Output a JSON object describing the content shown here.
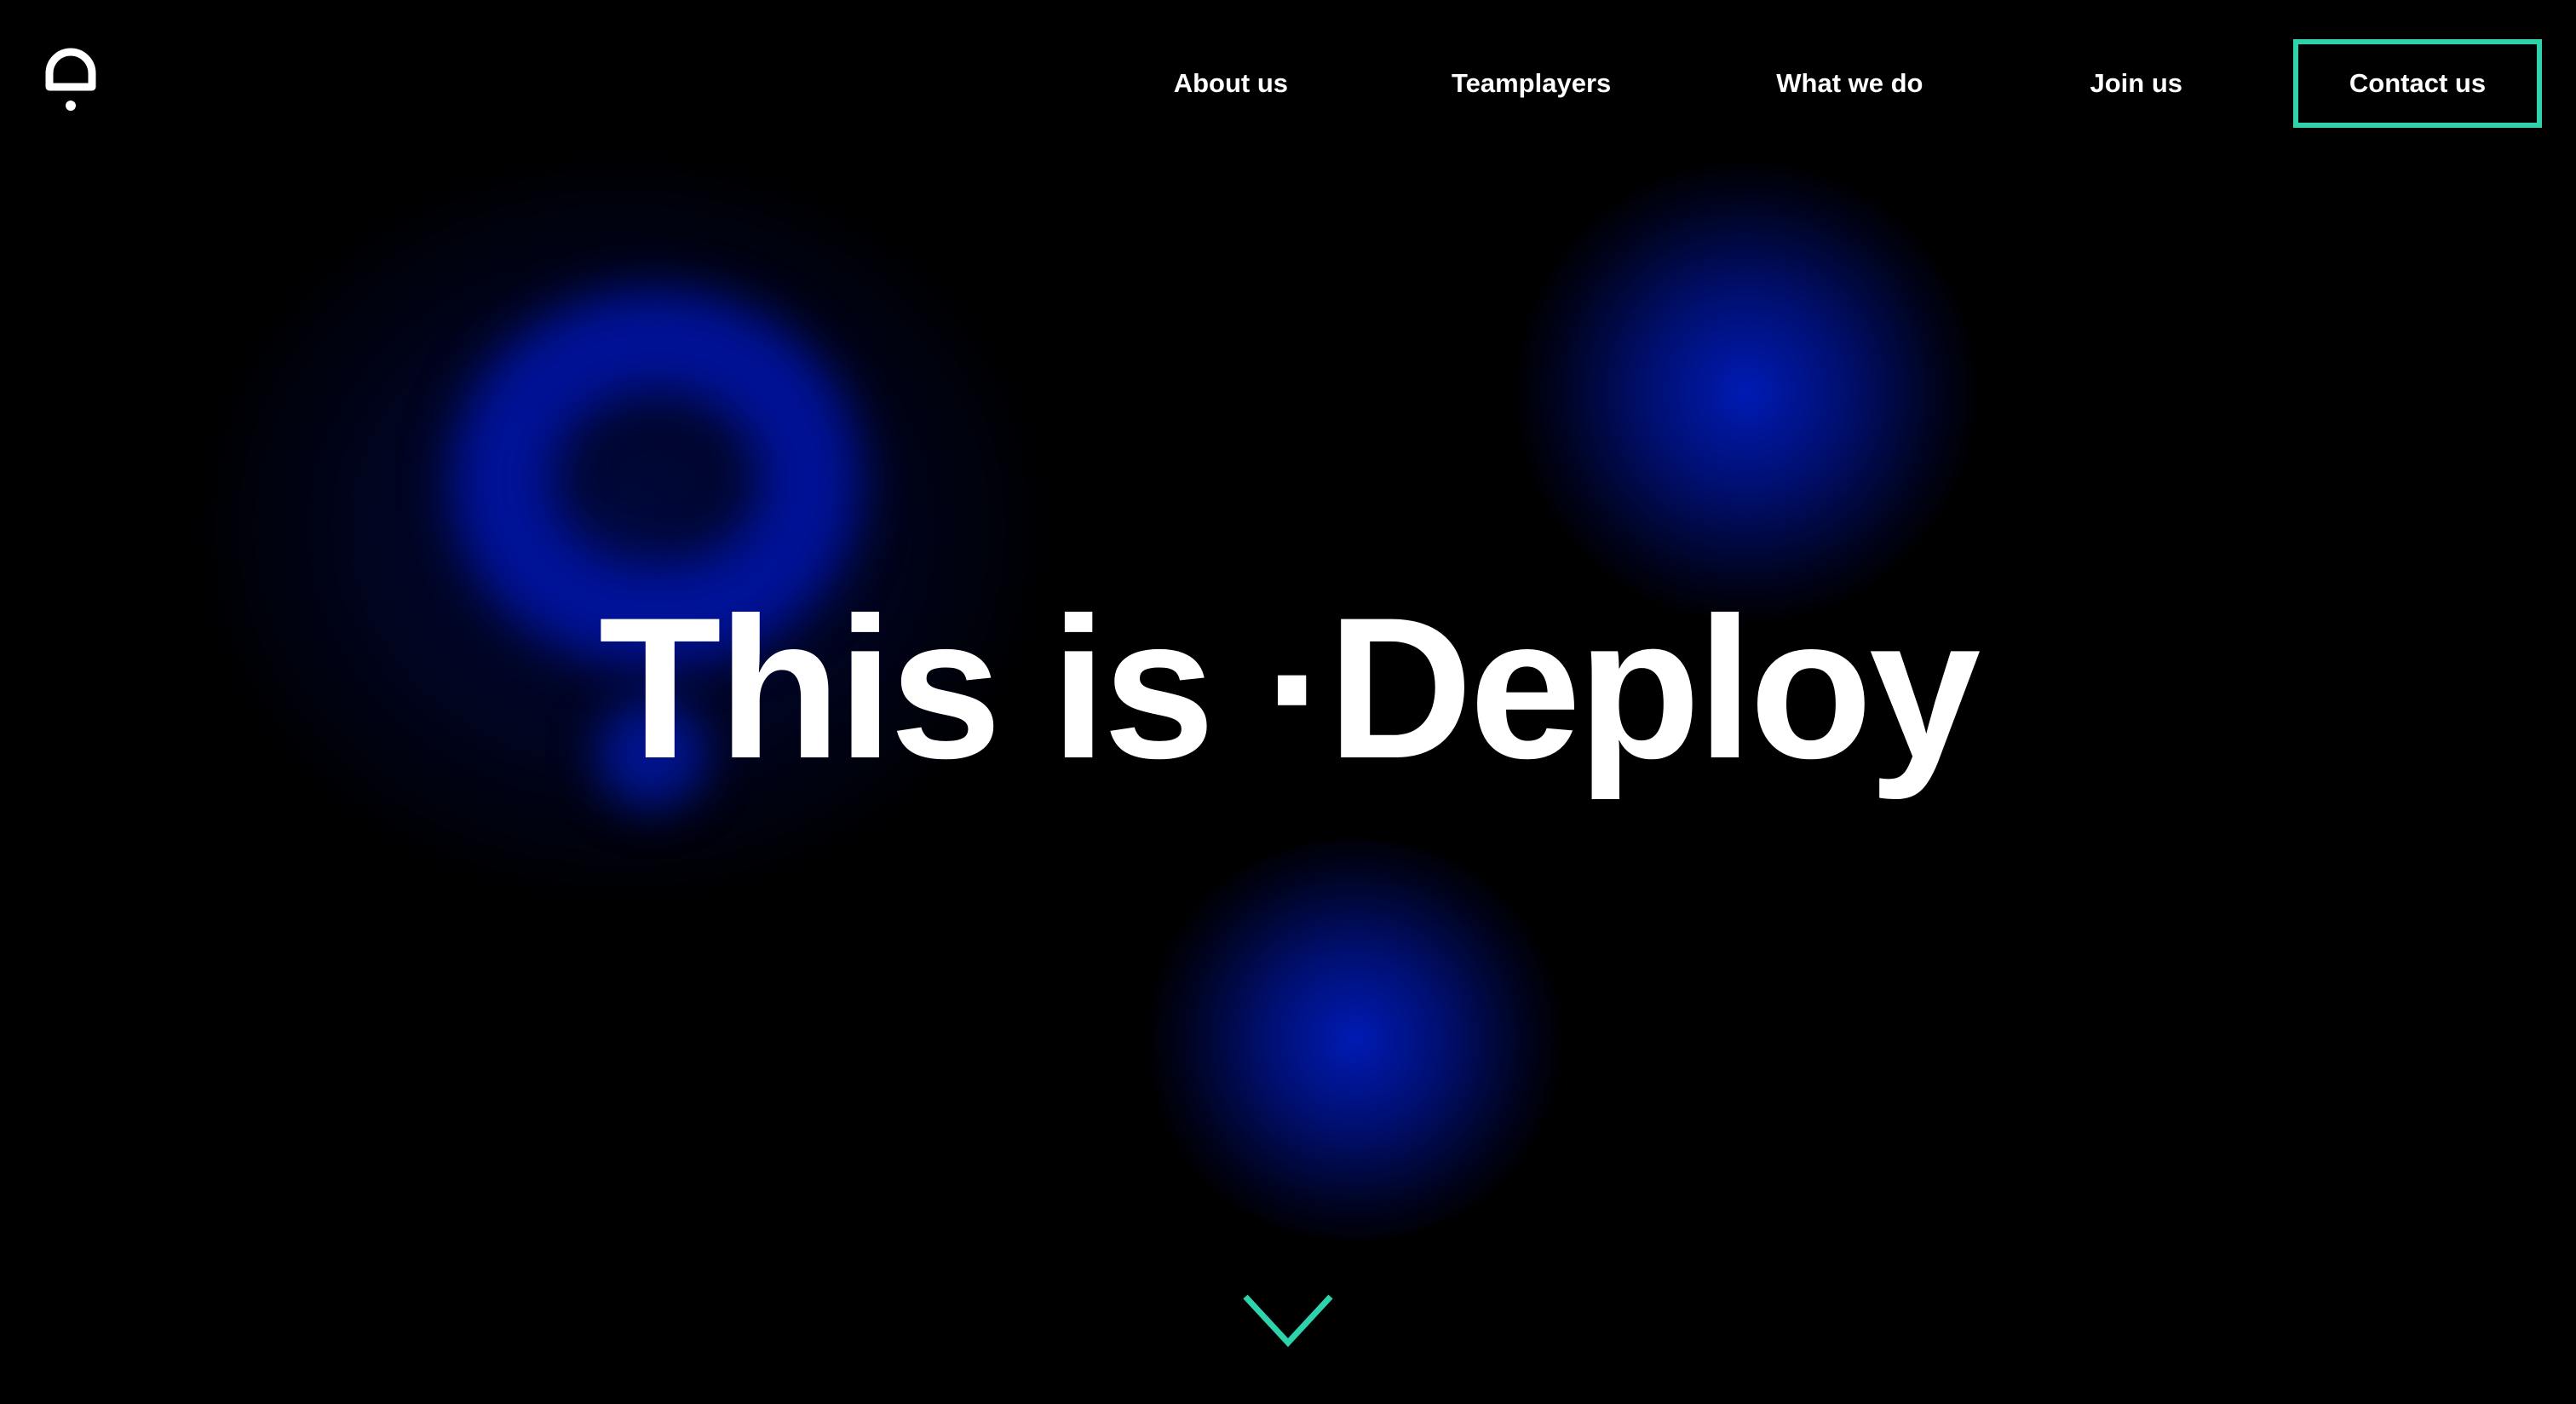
{
  "header": {
    "logo_icon": "deploy-logo-icon",
    "nav": {
      "about": "About us",
      "team": "Teamplayers",
      "what": "What we do",
      "join": "Join us"
    },
    "contact_label": "Contact us"
  },
  "hero": {
    "title": "This is ·Deploy"
  },
  "scroll": {
    "icon": "chevron-down-icon"
  },
  "colors": {
    "background": "#000000",
    "accent": "#2ed3ac",
    "glow": "#0018aa",
    "text": "#ffffff"
  }
}
